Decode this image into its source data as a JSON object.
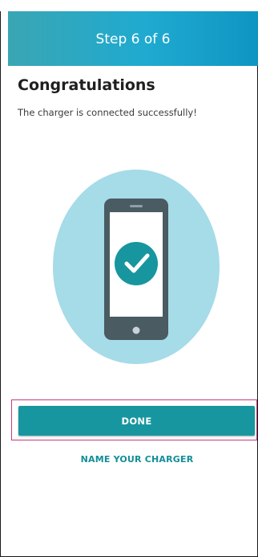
{
  "header": {
    "title": "Step 6 of 6"
  },
  "content": {
    "title": "Congratulations",
    "message": "The charger is connected successfully!"
  },
  "illustration": {
    "icon": "phone-checkmark-icon"
  },
  "actions": {
    "done_label": "DONE",
    "secondary_label": "NAME YOUR CHARGER"
  },
  "colors": {
    "header_gradient": [
      "#3aa6b3",
      "#1faad0",
      "#0f95c2"
    ],
    "primary": "#17969f",
    "illustration_circle": "#a6dbe8",
    "phone_body": "#4a5b62",
    "focus_outline": "#c43a7b"
  }
}
